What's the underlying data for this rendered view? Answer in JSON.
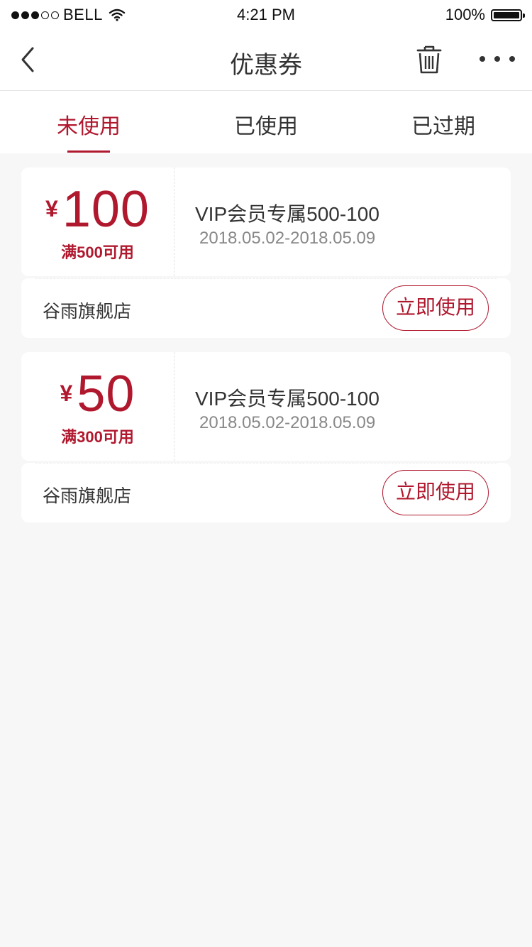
{
  "status_bar": {
    "carrier": "BELL",
    "time": "4:21 PM",
    "battery": "100%"
  },
  "nav": {
    "title": "优惠券",
    "icons": [
      "back-chevron-icon",
      "trash-icon",
      "more-icon"
    ]
  },
  "tabs": [
    {
      "label": "未使用",
      "active": true
    },
    {
      "label": "已使用",
      "active": false
    },
    {
      "label": "已过期",
      "active": false
    }
  ],
  "coupons": [
    {
      "currency": "¥",
      "amount": "100",
      "condition": "满500可用",
      "title": "VIP会员专属500-100",
      "date_range": "2018.05.02-2018.05.09",
      "store": "谷雨旗舰店",
      "action_label": "立即使用"
    },
    {
      "currency": "¥",
      "amount": "50",
      "condition": "满300可用",
      "title": "VIP会员专属500-100",
      "date_range": "2018.05.02-2018.05.09",
      "store": "谷雨旗舰店",
      "action_label": "立即使用"
    }
  ],
  "colors": {
    "accent": "#b0182e",
    "background": "#f7f7f7",
    "card": "#ffffff"
  }
}
